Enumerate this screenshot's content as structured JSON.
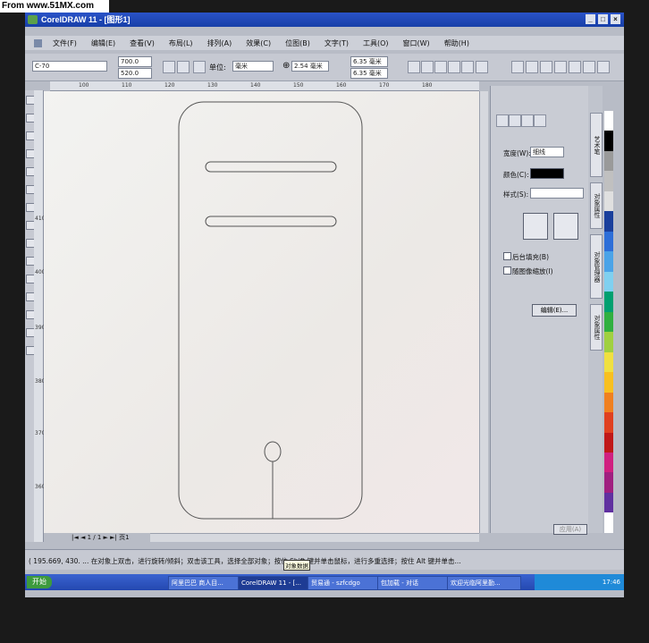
{
  "watermark": "From www.51MX.com",
  "window": {
    "title": "CorelDRAW 11 - [图形1]"
  },
  "menu": [
    "文件(F)",
    "编辑(E)",
    "查看(V)",
    "布局(L)",
    "排列(A)",
    "效果(C)",
    "位图(B)",
    "文字(T)",
    "工具(O)",
    "窗口(W)",
    "帮助(H)"
  ],
  "propbar": {
    "paper_select": "C-70",
    "width": "700.0",
    "height": "520.0",
    "unit_label": "单位:",
    "unit_value": "毫米",
    "nudge": "2.54 毫米",
    "dup_x": "6.35 毫米",
    "dup_y": "6.35 毫米"
  },
  "ruler_top_ticks": [
    "100",
    "110",
    "120",
    "130",
    "140",
    "150",
    "160",
    "170",
    "180"
  ],
  "ruler_left_ticks": [
    "410",
    "400",
    "390",
    "380",
    "370",
    "360"
  ],
  "page_nav": {
    "counter": "1 / 1",
    "page_tab": "页1"
  },
  "docker": {
    "width_label": "宽度(W):",
    "width_value": "细线",
    "color_label": "颜色(C):",
    "style_label": "样式(S):",
    "behind_fill": "后台填充(B)",
    "scale_with_image": "随图像缩放(I)",
    "edit_button": "编辑(E)...",
    "apply_button": "应用(A)"
  },
  "side_tabs": [
    "艺术笔",
    "对象属性",
    "对象管理器",
    "对象属性"
  ],
  "palette_colors": [
    "#ffffff",
    "#000000",
    "#9a9a9a",
    "#c0c0c0",
    "#e0e0e0",
    "#1a3f9c",
    "#2d6ed8",
    "#4aa3e8",
    "#7fd0f0",
    "#00a070",
    "#30b040",
    "#a0d040",
    "#f0e040",
    "#f8c020",
    "#f08020",
    "#e04020",
    "#c01818",
    "#d02080",
    "#a02080",
    "#6030a0",
    "#ffffff"
  ],
  "status": {
    "text": "( 195.669, 430. ... 在对象上双击，进行旋转/倾斜；双击该工具，选择全部对象；按住 Shift 键并单击鼠标，进行多重选择；按住 Alt 键并单击...",
    "tooltip": "对象数据"
  },
  "taskbar": {
    "start": "开始",
    "tasks": [
      "阿里巴巴 商人目...",
      "CorelDRAW 11 - [...",
      "贸易通 - szfcdgo",
      "包加载 - 对话",
      "欢迎光临阿里勤..."
    ],
    "clock": "17:46"
  }
}
